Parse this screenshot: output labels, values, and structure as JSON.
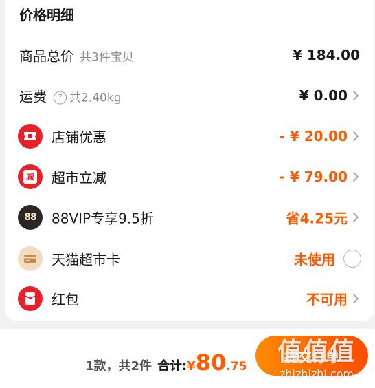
{
  "section_title": "价格明细",
  "rows": {
    "goods_total": {
      "label": "商品总价",
      "sub": "共3件宝贝",
      "value": "¥ 184.00"
    },
    "shipping": {
      "label": "运费",
      "help_glyph": "?",
      "sub": "共2.40kg",
      "value": "¥ 0.00"
    },
    "store_discount": {
      "label": "店铺优惠",
      "value": "- ¥ 20.00",
      "icon": "ticket-icon"
    },
    "supermarket_discount": {
      "label": "超市立减",
      "value": "- ¥ 79.00",
      "icon": "reduce-icon",
      "icon_text": "减"
    },
    "vip_discount": {
      "label": "88VIP专享9.5折",
      "value": "省4.25元",
      "icon": "vip-88-icon",
      "icon_text": "88"
    },
    "tmall_card": {
      "label": "天猫超市卡",
      "value": "未使用",
      "icon": "card-icon"
    },
    "red_packet": {
      "label": "红包",
      "value": "不可用",
      "icon": "red-packet-icon"
    }
  },
  "footer": {
    "count": "1款，共2件",
    "total_label": "合计:",
    "currency": "¥",
    "total_int": "80",
    "total_dec": ".75",
    "checkout_label": "提交订单"
  },
  "watermark": {
    "main": "值值值",
    "sub": "zhizhizhi.com"
  },
  "colors": {
    "accent": "#ff5a00",
    "icon_red": "#e8202a",
    "vip_dark": "#2a2623"
  }
}
